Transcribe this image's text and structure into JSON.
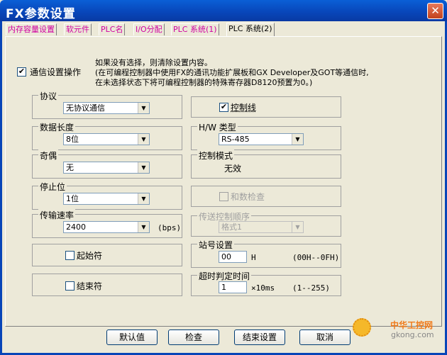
{
  "window": {
    "title": "FX参数设置",
    "close": "✕"
  },
  "tabs": [
    "内存容量设置",
    "软元件",
    "PLC名",
    "I/O分配",
    "PLC 系统(1)",
    "PLC 系统(2)"
  ],
  "comm": {
    "label": "通信设置操作",
    "checked": "✔",
    "note1": "如果没有选择，则清除设置内容。",
    "note2": "(在可编程控制器中使用FX的通讯功能扩展板和GX Developer及GOT等通信时,",
    "note3": "在未选择状态下将可编程控制器的特殊寄存器D8120预置为0。)"
  },
  "protocol": {
    "label": "协议",
    "value": "无协议通信"
  },
  "data_length": {
    "label": "数据长度",
    "value": "8位"
  },
  "parity": {
    "label": "奇偶",
    "value": "无"
  },
  "stop_bit": {
    "label": "停止位",
    "value": "1位"
  },
  "baud": {
    "label": "传输速率",
    "value": "2400",
    "unit": "(bps)"
  },
  "start_char": {
    "label": "起始符"
  },
  "end_char": {
    "label": "结束符"
  },
  "control_line": {
    "label": "控制线",
    "checked": "✔"
  },
  "hw_type": {
    "label": "H/W 类型",
    "value": "RS-485"
  },
  "control_mode": {
    "label": "控制模式",
    "value": "无效"
  },
  "sum_check": {
    "label": "和数检查"
  },
  "transfer_order": {
    "label": "传送控制顺序",
    "value": "格式1"
  },
  "station": {
    "label": "站号设置",
    "value": "00",
    "unit": "H",
    "range": "(00H--0FH)"
  },
  "timeout": {
    "label": "超时判定时间",
    "value": "1",
    "unit": "×10ms",
    "range": "(1--255)"
  },
  "buttons": {
    "default": "默认值",
    "check": "检查",
    "end": "结束设置",
    "cancel": "取消"
  },
  "watermark": {
    "brand": "中华工控网",
    "site": "gkong.com"
  }
}
